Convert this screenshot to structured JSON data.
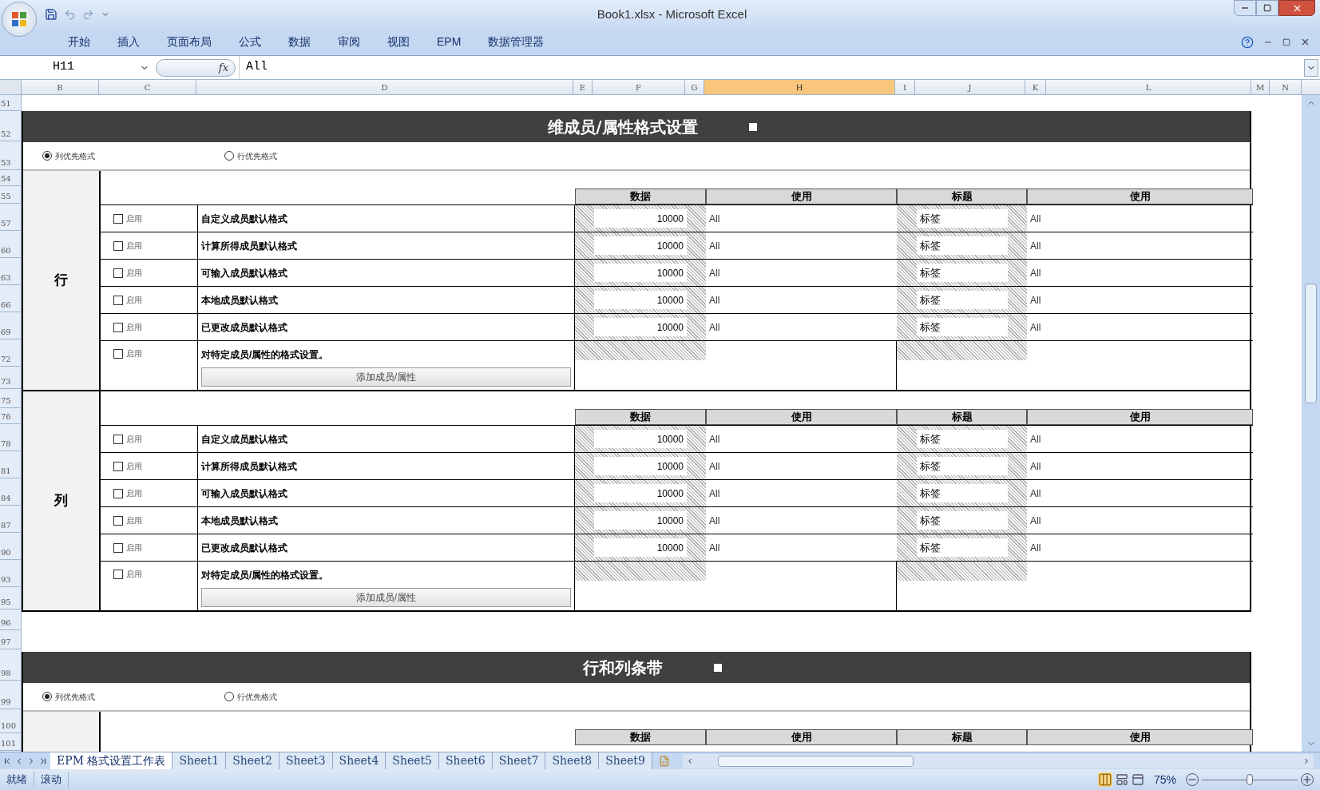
{
  "window": {
    "title": "Book1.xlsx - Microsoft Excel"
  },
  "ribbon_tabs": [
    "开始",
    "插入",
    "页面布局",
    "公式",
    "数据",
    "审阅",
    "视图",
    "EPM",
    "数据管理器"
  ],
  "formula_bar": {
    "name_box": "H11",
    "function_button": "fx",
    "formula": "All"
  },
  "column_headers": [
    {
      "label": "B",
      "selected": false
    },
    {
      "label": "C",
      "selected": false
    },
    {
      "label": "D",
      "selected": false
    },
    {
      "label": "E",
      "selected": false
    },
    {
      "label": "F",
      "selected": false
    },
    {
      "label": "G",
      "selected": false
    },
    {
      "label": "H",
      "selected": true
    },
    {
      "label": "I",
      "selected": false
    },
    {
      "label": "J",
      "selected": false
    },
    {
      "label": "K",
      "selected": false
    },
    {
      "label": "L",
      "selected": false
    },
    {
      "label": "M",
      "selected": false
    },
    {
      "label": "N",
      "selected": false
    }
  ],
  "row_numbers": [
    "51",
    "52",
    "53",
    "54",
    "55",
    "57",
    "60",
    "63",
    "66",
    "69",
    "72",
    "73",
    "75",
    "76",
    "78",
    "81",
    "84",
    "87",
    "90",
    "93",
    "95",
    "96",
    "97",
    "98",
    "99",
    "100",
    "101"
  ],
  "sections": [
    {
      "title": "维成员/属性格式设置",
      "radios": [
        {
          "label": "列优先格式",
          "selected": true
        },
        {
          "label": "行优先格式",
          "selected": false
        }
      ],
      "blocks": [
        {
          "label": "行",
          "headers": [
            "数据",
            "使用",
            "标题",
            "使用"
          ],
          "rows": [
            {
              "kind": "default",
              "checkbox_label": "启用",
              "checked": false,
              "name": "自定义成员默认格式",
              "data": "10000",
              "data_use": "All",
              "title": "标签",
              "title_use": "All"
            },
            {
              "kind": "default",
              "checkbox_label": "启用",
              "checked": false,
              "name": "计算所得成员默认格式",
              "data": "10000",
              "data_use": "All",
              "title": "标签",
              "title_use": "All"
            },
            {
              "kind": "default",
              "checkbox_label": "启用",
              "checked": false,
              "name": "可输入成员默认格式",
              "data": "10000",
              "data_use": "All",
              "title": "标签",
              "title_use": "All"
            },
            {
              "kind": "default",
              "checkbox_label": "启用",
              "checked": false,
              "name": "本地成员默认格式",
              "data": "10000",
              "data_use": "All",
              "title": "标签",
              "title_use": "All"
            },
            {
              "kind": "default",
              "checkbox_label": "启用",
              "checked": false,
              "name": "已更改成员默认格式",
              "data": "10000",
              "data_use": "All",
              "title": "标签",
              "title_use": "All"
            },
            {
              "kind": "specific",
              "checkbox_label": "启用",
              "checked": false,
              "name": "对特定成员/属性的格式设置。",
              "button": "添加成员/属性"
            }
          ]
        },
        {
          "label": "列",
          "headers": [
            "数据",
            "使用",
            "标题",
            "使用"
          ],
          "rows": [
            {
              "kind": "default",
              "checkbox_label": "启用",
              "checked": false,
              "name": "自定义成员默认格式",
              "data": "10000",
              "data_use": "All",
              "title": "标签",
              "title_use": "All"
            },
            {
              "kind": "default",
              "checkbox_label": "启用",
              "checked": false,
              "name": "计算所得成员默认格式",
              "data": "10000",
              "data_use": "All",
              "title": "标签",
              "title_use": "All"
            },
            {
              "kind": "default",
              "checkbox_label": "启用",
              "checked": false,
              "name": "可输入成员默认格式",
              "data": "10000",
              "data_use": "All",
              "title": "标签",
              "title_use": "All"
            },
            {
              "kind": "default",
              "checkbox_label": "启用",
              "checked": false,
              "name": "本地成员默认格式",
              "data": "10000",
              "data_use": "All",
              "title": "标签",
              "title_use": "All"
            },
            {
              "kind": "default",
              "checkbox_label": "启用",
              "checked": false,
              "name": "已更改成员默认格式",
              "data": "10000",
              "data_use": "All",
              "title": "标签",
              "title_use": "All"
            },
            {
              "kind": "specific",
              "checkbox_label": "启用",
              "checked": false,
              "name": "对特定成员/属性的格式设置。",
              "button": "添加成员/属性"
            }
          ]
        }
      ]
    },
    {
      "title": "行和列条带",
      "radios": [
        {
          "label": "列优先格式",
          "selected": true
        },
        {
          "label": "行优先格式",
          "selected": false
        }
      ],
      "blocks": [
        {
          "headers": [
            "数据",
            "使用",
            "标题",
            "使用"
          ]
        }
      ]
    }
  ],
  "sheet_tabs": [
    {
      "label": "EPM 格式设置工作表",
      "selected": true
    },
    {
      "label": "Sheet1",
      "selected": false
    },
    {
      "label": "Sheet2",
      "selected": false
    },
    {
      "label": "Sheet3",
      "selected": false
    },
    {
      "label": "Sheet4",
      "selected": false
    },
    {
      "label": "Sheet5",
      "selected": false
    },
    {
      "label": "Sheet6",
      "selected": false
    },
    {
      "label": "Sheet7",
      "selected": false
    },
    {
      "label": "Sheet8",
      "selected": false
    },
    {
      "label": "Sheet9",
      "selected": false
    }
  ],
  "status_bar": {
    "items": [
      "就绪",
      "滚动"
    ],
    "zoom": "75%",
    "zoom_slider": {
      "level": 0.5
    }
  }
}
